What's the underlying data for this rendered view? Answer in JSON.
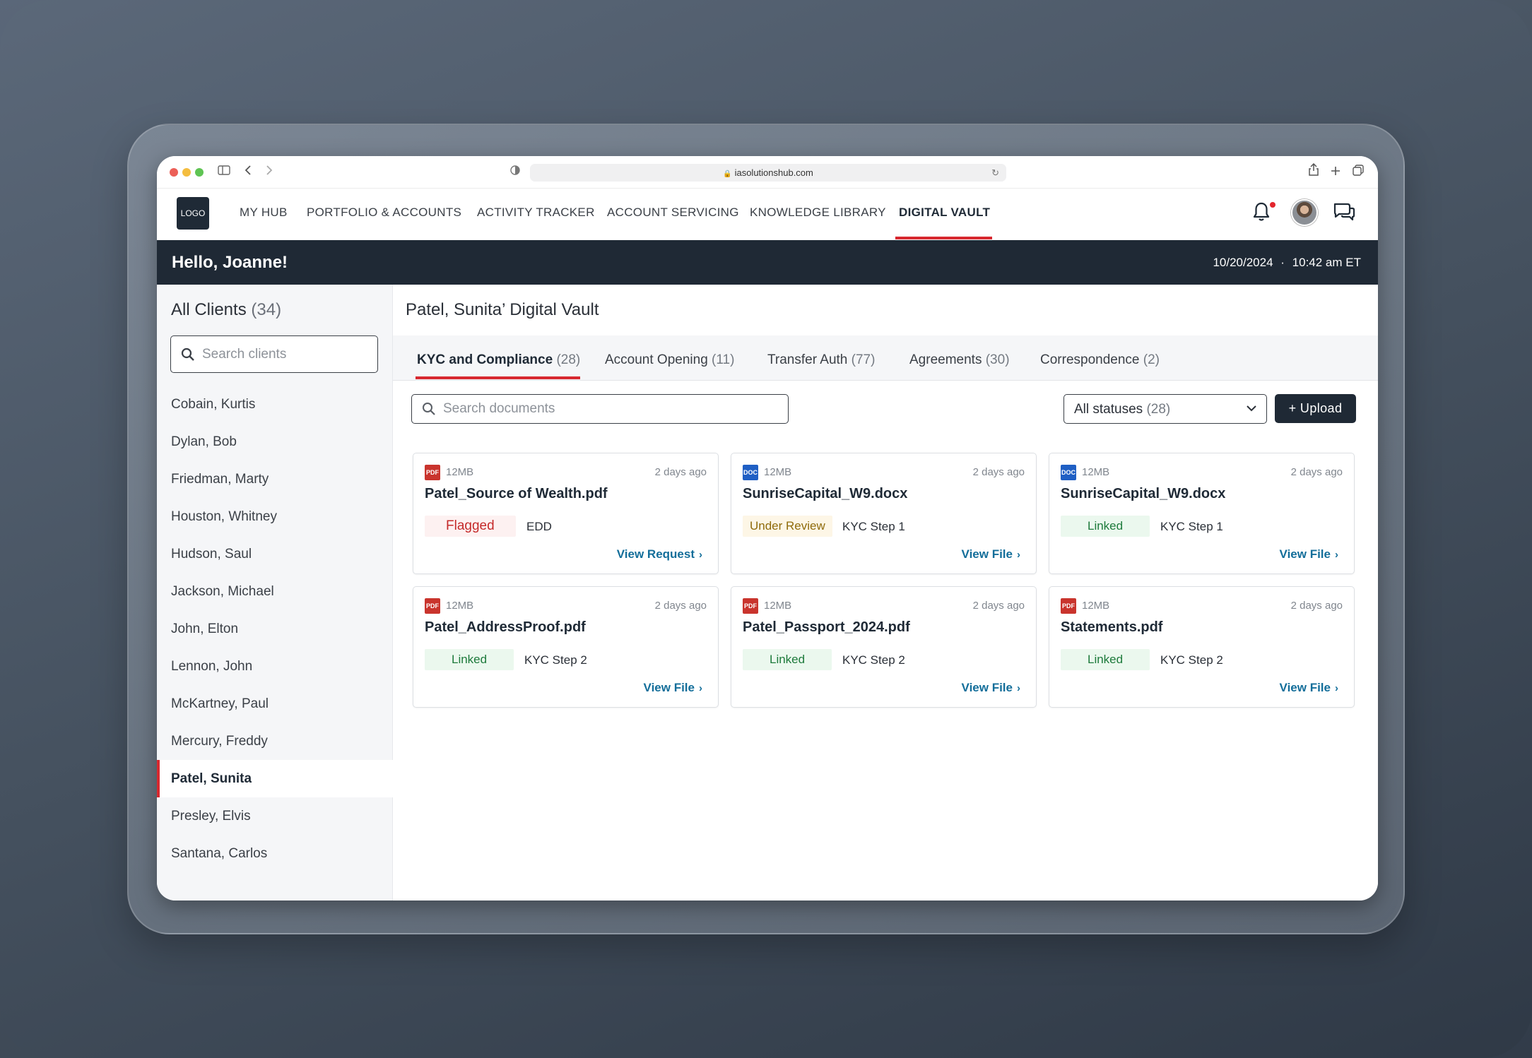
{
  "browser": {
    "url": "iasolutionshub.com"
  },
  "app": {
    "logo_text": "LOGO",
    "nav": [
      {
        "label": "MY HUB"
      },
      {
        "label": "PORTFOLIO & ACCOUNTS"
      },
      {
        "label": "ACTIVITY TRACKER"
      },
      {
        "label": "ACCOUNT SERVICING"
      },
      {
        "label": "KNOWLEDGE LIBRARY"
      },
      {
        "label": "DIGITAL VAULT"
      }
    ],
    "active_nav": "DIGITAL VAULT",
    "accent_color": "#d7282f",
    "header_dark": "#1f2935"
  },
  "greeting": {
    "text": "Hello, Joanne!",
    "date": "10/20/2024",
    "separator": "·",
    "time": "10:42 am ET"
  },
  "sidebar": {
    "title": "All Clients",
    "count": "(34)",
    "search_placeholder": "Search clients",
    "clients": [
      {
        "name": "Cobain, Kurtis"
      },
      {
        "name": "Dylan, Bob"
      },
      {
        "name": "Friedman, Marty"
      },
      {
        "name": "Houston, Whitney"
      },
      {
        "name": "Hudson, Saul"
      },
      {
        "name": "Jackson, Michael"
      },
      {
        "name": "John, Elton"
      },
      {
        "name": "Lennon, John"
      },
      {
        "name": "McKartney, Paul"
      },
      {
        "name": "Mercury, Freddy"
      },
      {
        "name": "Patel, Sunita"
      },
      {
        "name": "Presley, Elvis"
      },
      {
        "name": "Santana, Carlos"
      }
    ],
    "selected_client": "Patel, Sunita"
  },
  "main": {
    "title": "Patel, Sunita’ Digital Vault",
    "tabs": [
      {
        "label": "KYC and Compliance",
        "count": "(28)"
      },
      {
        "label": "Account Opening",
        "count": "(11)"
      },
      {
        "label": "Transfer Auth",
        "count": "(77)"
      },
      {
        "label": "Agreements",
        "count": "(30)"
      },
      {
        "label": "Correspondence",
        "count": "(2)"
      }
    ],
    "active_tab": "KYC and Compliance",
    "doc_search_placeholder": "Search documents",
    "status_filter": {
      "label": "All statuses",
      "count": "(28)"
    },
    "upload_label": "+ Upload",
    "documents": [
      {
        "type": "PDF",
        "size": "12MB",
        "age": "2 days ago",
        "name": "Patel_Source of Wealth.pdf",
        "status": "Flagged",
        "step": "EDD",
        "action": "View Request"
      },
      {
        "type": "DOC",
        "size": "12MB",
        "age": "2 days ago",
        "name": "SunriseCapital_W9.docx",
        "status": "Under Review",
        "step": "KYC Step 1",
        "action": "View File"
      },
      {
        "type": "DOC",
        "size": "12MB",
        "age": "2 days ago",
        "name": "SunriseCapital_W9.docx",
        "status": "Linked",
        "step": "KYC Step 1",
        "action": "View File"
      },
      {
        "type": "PDF",
        "size": "12MB",
        "age": "2 days ago",
        "name": "Patel_AddressProof.pdf",
        "status": "Linked",
        "step": "KYC Step 2",
        "action": "View File"
      },
      {
        "type": "PDF",
        "size": "12MB",
        "age": "2 days ago",
        "name": "Patel_Passport_2024.pdf",
        "status": "Linked",
        "step": "KYC Step 2",
        "action": "View File"
      },
      {
        "type": "PDF",
        "size": "12MB",
        "age": "2 days ago",
        "name": "Statements.pdf",
        "status": "Linked",
        "step": "KYC Step 2",
        "action": "View File"
      }
    ]
  }
}
